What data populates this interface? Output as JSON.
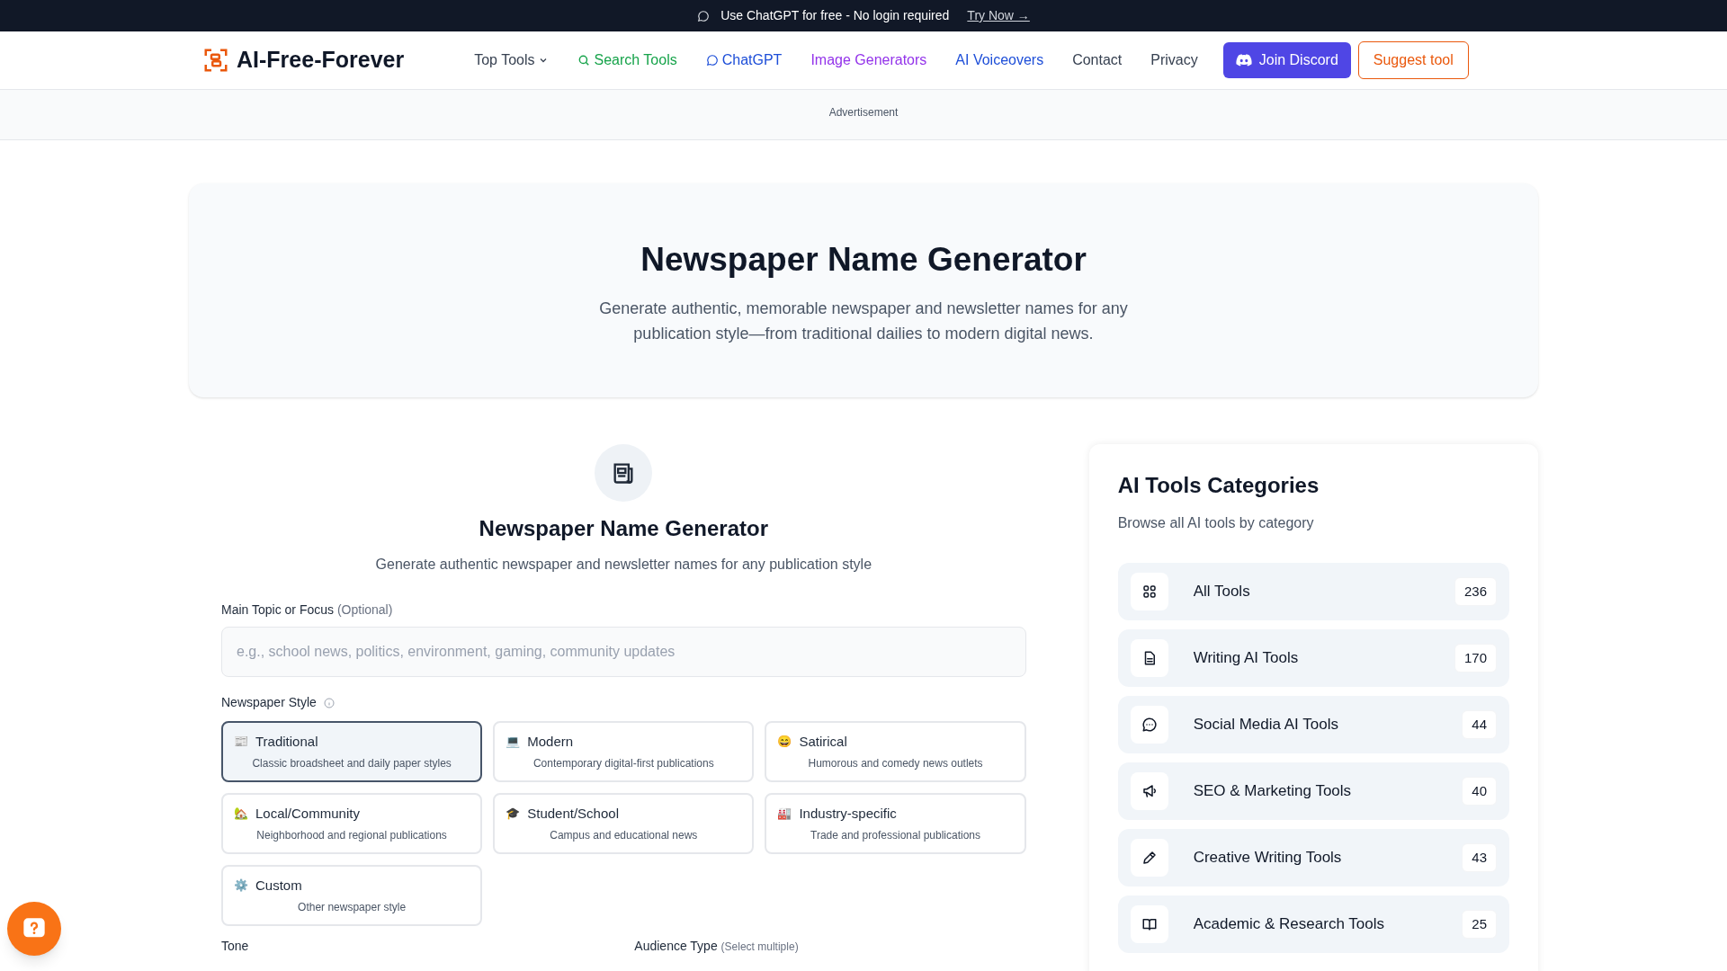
{
  "announcement": {
    "text": "Use ChatGPT for free - No login required",
    "link": "Try Now →"
  },
  "nav": {
    "logo": "AI-Free-Forever",
    "links": [
      {
        "label": "Top Tools",
        "kind": "dropdown",
        "color": "#374151"
      },
      {
        "label": "Search Tools",
        "kind": "search",
        "color": "#16a34a"
      },
      {
        "label": "ChatGPT",
        "kind": "chat",
        "color": "#1d4ed8"
      },
      {
        "label": "Image Generators",
        "kind": "plain",
        "color": "#9333ea"
      },
      {
        "label": "AI Voiceovers",
        "kind": "plain",
        "color": "#1d4ed8"
      },
      {
        "label": "Contact",
        "kind": "plain",
        "color": "#374151"
      },
      {
        "label": "Privacy",
        "kind": "plain",
        "color": "#374151"
      }
    ],
    "discord": "Join Discord",
    "suggest": "Suggest tool"
  },
  "ad_label": "Advertisement",
  "hero": {
    "title": "Newspaper Name Generator",
    "subtitle": "Generate authentic, memorable newspaper and newsletter names for any publication style—from traditional dailies to modern digital news."
  },
  "tool": {
    "title": "Newspaper Name Generator",
    "subtitle": "Generate authentic newspaper and newsletter names for any publication style",
    "topic": {
      "label": "Main Topic or Focus",
      "hint": "(Optional)",
      "placeholder": "e.g., school news, politics, environment, gaming, community updates"
    },
    "style_label": "Newspaper Style",
    "styles": [
      {
        "icon": "📰",
        "title": "Traditional",
        "desc": "Classic broadsheet and daily paper styles",
        "selected": true
      },
      {
        "icon": "💻",
        "title": "Modern",
        "desc": "Contemporary digital-first publications",
        "selected": false
      },
      {
        "icon": "😄",
        "title": "Satirical",
        "desc": "Humorous and comedy news outlets",
        "selected": false
      },
      {
        "icon": "🏡",
        "title": "Local/Community",
        "desc": "Neighborhood and regional publications",
        "selected": false
      },
      {
        "icon": "🎓",
        "title": "Student/School",
        "desc": "Campus and educational news",
        "selected": false
      },
      {
        "icon": "🏭",
        "title": "Industry-specific",
        "desc": "Trade and professional publications",
        "selected": false
      },
      {
        "icon": "⚙️",
        "title": "Custom",
        "desc": "Other newspaper style",
        "selected": false
      }
    ],
    "tone_label": "Tone",
    "audience_label": "Audience Type",
    "audience_hint": "(Select multiple)"
  },
  "sidebar": {
    "title": "AI Tools Categories",
    "subtitle": "Browse all AI tools by category",
    "categories": [
      {
        "kind": "grid",
        "label": "All Tools",
        "count": "236"
      },
      {
        "kind": "document",
        "label": "Writing AI Tools",
        "count": "170"
      },
      {
        "kind": "chat",
        "label": "Social Media AI Tools",
        "count": "44"
      },
      {
        "kind": "megaphone",
        "label": "SEO & Marketing Tools",
        "count": "40"
      },
      {
        "kind": "pencil",
        "label": "Creative Writing Tools",
        "count": "43"
      },
      {
        "kind": "book",
        "label": "Academic & Research Tools",
        "count": "25"
      }
    ]
  }
}
